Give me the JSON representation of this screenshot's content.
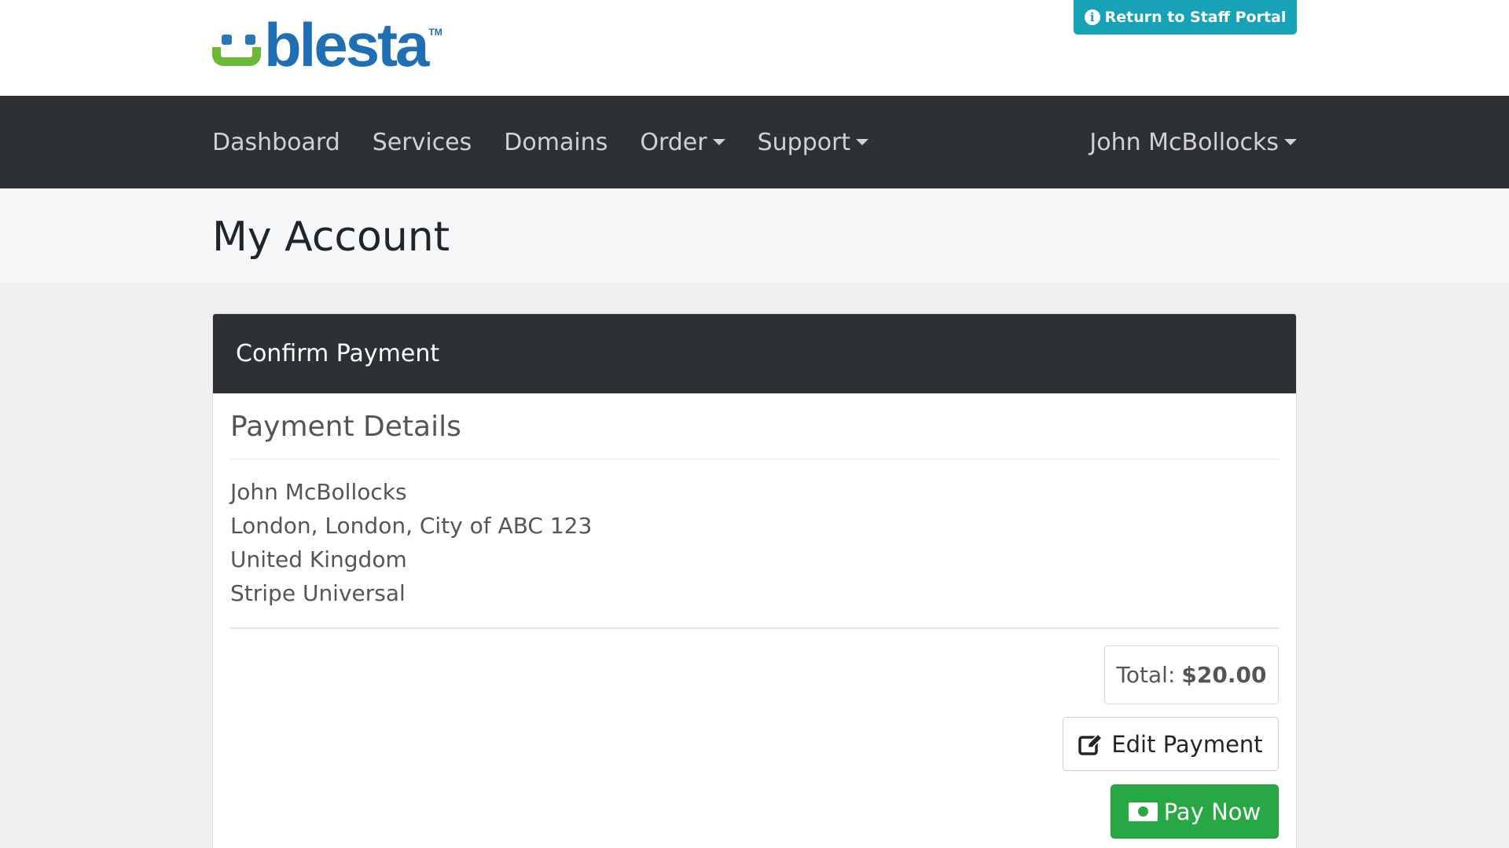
{
  "header": {
    "logo_text": "blesta",
    "logo_tm": "TM",
    "staff_button_label": "Return to Staff Portal"
  },
  "nav": {
    "items": [
      {
        "label": "Dashboard"
      },
      {
        "label": "Services"
      },
      {
        "label": "Domains"
      },
      {
        "label": "Order"
      },
      {
        "label": "Support"
      }
    ],
    "user_label": "John McBollocks"
  },
  "page": {
    "title": "My Account"
  },
  "card": {
    "header": "Confirm Payment",
    "section_title": "Payment Details",
    "address_lines": [
      "John McBollocks",
      "London, London, City of ABC 123",
      "United Kingdom",
      "Stripe Universal"
    ],
    "total_label": "Total:",
    "total_value": "$20.00",
    "edit_button_label": "Edit Payment",
    "pay_button_label": "Pay Now"
  },
  "colors": {
    "navbar": "#2d3135",
    "staff_button": "#17a2b8",
    "pay_button": "#28a745",
    "logo_blue": "#1f6fb4",
    "logo_green": "#6bb935"
  },
  "icons": {
    "staff": "info-circle-icon",
    "edit": "edit-square-icon",
    "pay": "money-bill-icon",
    "dropdown": "caret-down-icon"
  }
}
